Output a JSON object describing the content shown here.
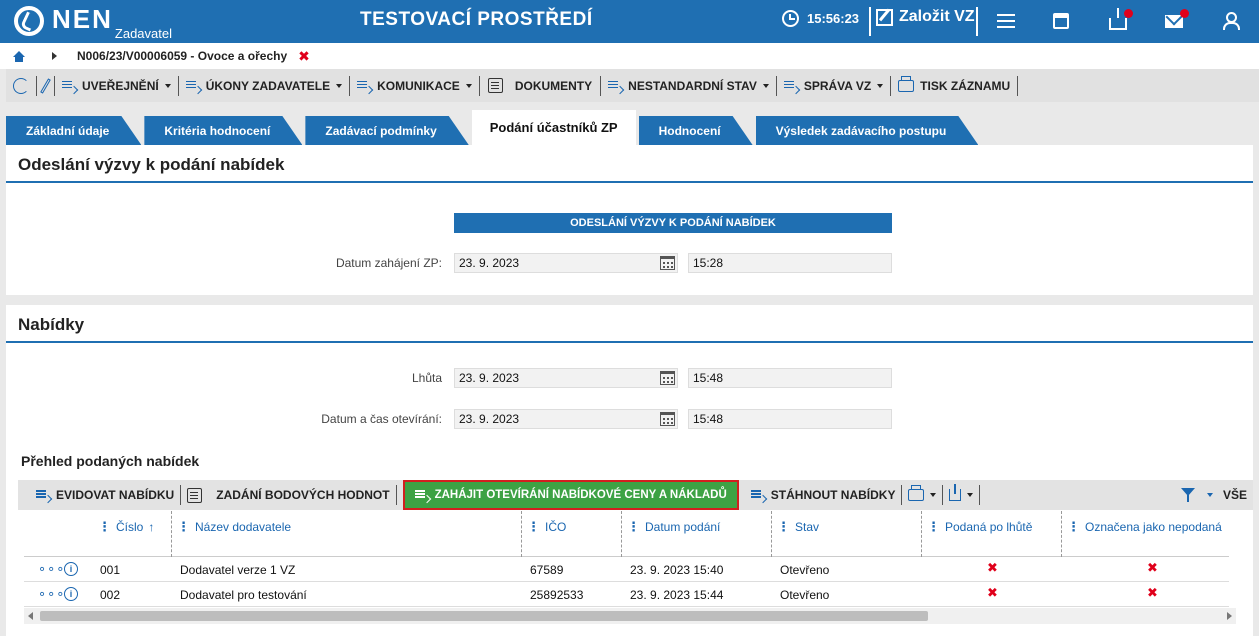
{
  "header": {
    "logo_text": "NEN",
    "logo_sub": "Zadavatel",
    "environment": "TESTOVACÍ PROSTŘEDÍ",
    "time": "15:56:23",
    "create_label": "Založit VZ"
  },
  "breadcrumb": {
    "text": "N006/23/V00006059 - Ovoce a ořechy",
    "close": "✖"
  },
  "toolbar": {
    "items": [
      "UVEŘEJNĚNÍ",
      "ÚKONY ZADAVATELE",
      "KOMUNIKACE",
      "DOKUMENTY",
      "NESTANDARDNÍ STAV",
      "SPRÁVA VZ",
      "TISK ZÁZNAMU"
    ]
  },
  "tabs": [
    "Základní údaje",
    "Kritéria hodnocení",
    "Zadávací podmínky",
    "Podání účastníků ZP",
    "Hodnocení",
    "Výsledek zadávacího postupu"
  ],
  "section1": {
    "title": "Odeslání výzvy k podání nabídek",
    "header_bar": "ODESLÁNÍ VÝZVY K PODÁNÍ NABÍDEK",
    "date_label": "Datum zahájení ZP:",
    "date_value": "23. 9. 2023",
    "time_value": "15:28"
  },
  "section2": {
    "title": "Nabídky",
    "deadline_label": "Lhůta",
    "deadline_date": "23. 9. 2023",
    "deadline_time": "15:48",
    "open_label": "Datum a čas otevírání:",
    "open_date": "23. 9. 2023",
    "open_time": "15:48",
    "overview_title": "Přehled podaných nabídek"
  },
  "grid_toolbar": {
    "register": "EVIDOVAT NABÍDKU",
    "scores": "ZADÁNÍ BODOVÝCH HODNOT",
    "start_opening": "ZAHÁJIT OTEVÍRÁNÍ NABÍDKOVÉ CENY A NÁKLADŮ",
    "download": "STÁHNOUT NABÍDKY",
    "all": "VŠE"
  },
  "table": {
    "columns": [
      "Číslo",
      "Název dodavatele",
      "IČO",
      "Datum podání",
      "Stav",
      "Podaná po lhůtě",
      "Označena jako nepodaná"
    ],
    "sort_arrow": "↑",
    "rows": [
      {
        "num": "001",
        "name": "Dodavatel verze 1 VZ",
        "ico": "67589",
        "date": "23. 9. 2023 15:40",
        "state": "Otevřeno",
        "late": "✖",
        "marked": "✖"
      },
      {
        "num": "002",
        "name": "Dodavatel pro testování",
        "ico": "25892533",
        "date": "23. 9. 2023 15:44",
        "state": "Otevřeno",
        "late": "✖",
        "marked": "✖"
      }
    ]
  }
}
